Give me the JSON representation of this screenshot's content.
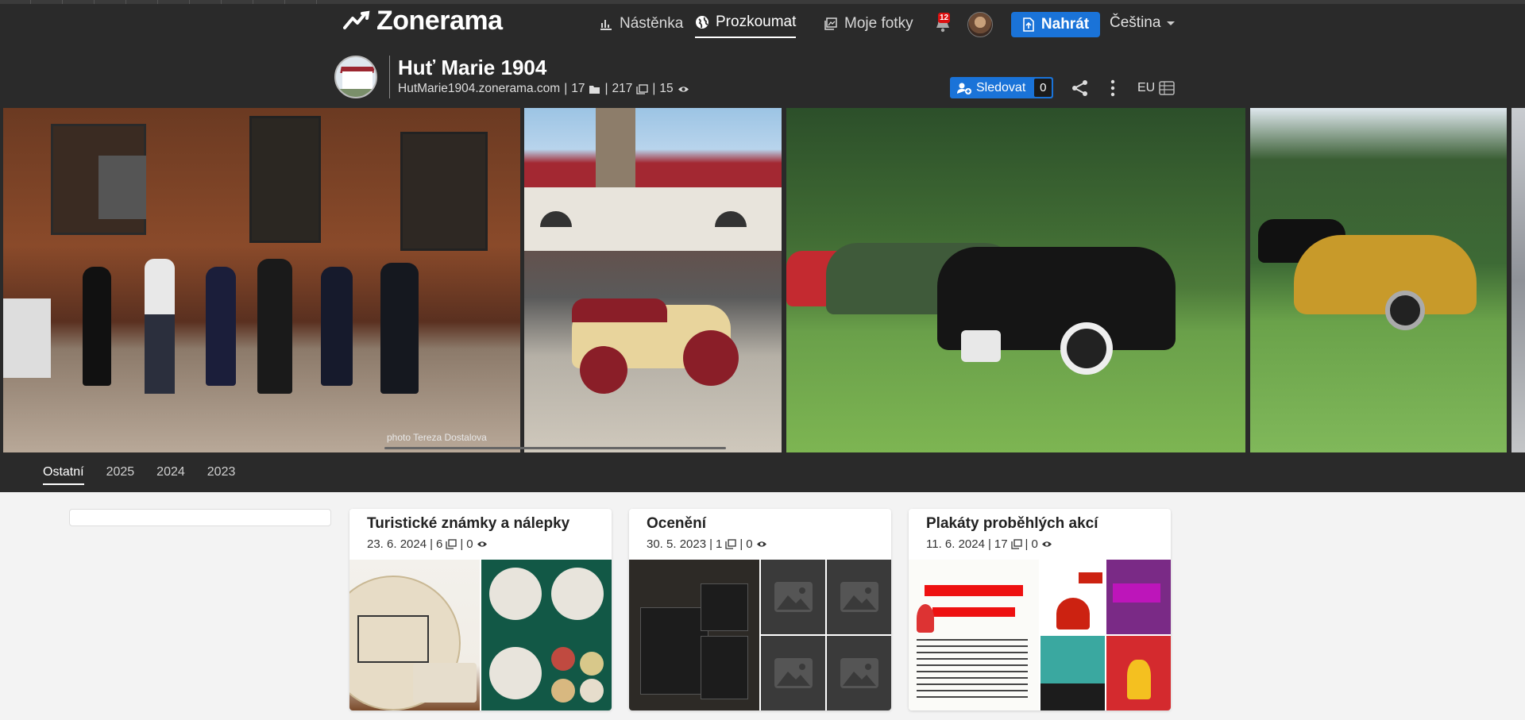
{
  "header": {
    "logo_text": "Zonerama",
    "nav": [
      {
        "label": "Nástěnka",
        "icon": "chart-icon",
        "active": false
      },
      {
        "label": "Prozkoumat",
        "icon": "globe-icon",
        "active": true
      },
      {
        "label": "Moje fotky",
        "icon": "photos-icon",
        "active": false
      }
    ],
    "notification_count": "12",
    "upload_label": "Nahrát",
    "language": "Čeština"
  },
  "profile": {
    "name": "Huť Marie 1904",
    "domain": "HutMarie1904.zonerama.com",
    "albums_count": "17",
    "photos_count": "217",
    "views_count": "15",
    "separator": "|",
    "follow_label": "Sledovat",
    "followers_count": "0",
    "region": "EU"
  },
  "photo_strip": {
    "credit": "photo Tereza Dostalova"
  },
  "tabs": [
    {
      "label": "Ostatní",
      "active": true
    },
    {
      "label": "2025",
      "active": false
    },
    {
      "label": "2024",
      "active": false
    },
    {
      "label": "2023",
      "active": false
    }
  ],
  "albums": [
    {
      "title": "Turistické známky a nálepky",
      "date": "23. 6. 2024",
      "photos": "6",
      "views": "0"
    },
    {
      "title": "Ocenění",
      "date": "30. 5. 2023",
      "photos": "1",
      "views": "0"
    },
    {
      "title": "Plakáty proběhlých akcí",
      "date": "11. 6. 2024",
      "photos": "17",
      "views": "0"
    }
  ],
  "colors": {
    "header_bg": "#2a2a2a",
    "accent": "#1a73d8",
    "page_bg": "#f3f3f3"
  }
}
